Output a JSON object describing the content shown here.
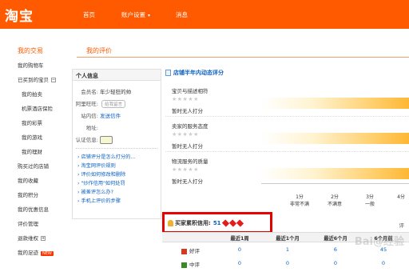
{
  "header": {
    "logo": "淘宝",
    "nav": [
      {
        "label": "首页"
      },
      {
        "label": "账户设置"
      },
      {
        "label": "消息"
      }
    ]
  },
  "tabs": [
    {
      "label": "我的评价"
    }
  ],
  "sidebar": {
    "title": "我的交易",
    "items": [
      {
        "label": "我的购物车"
      },
      {
        "label": "已买到的宝贝"
      },
      {
        "label": "我的拍卖"
      },
      {
        "label": "机票酒店保险"
      },
      {
        "label": "我的彩票"
      },
      {
        "label": "我的游戏"
      },
      {
        "label": "我的理财"
      },
      {
        "label": "购买过的店铺"
      },
      {
        "label": "我的收藏"
      },
      {
        "label": "我的积分"
      },
      {
        "label": "我的优惠信息"
      },
      {
        "label": "评价管理"
      },
      {
        "label": "退款维权"
      },
      {
        "label": "我的足迹",
        "badge": "NEW"
      }
    ]
  },
  "profile": {
    "title": "个人信息",
    "member_label": "会员名:",
    "member_value": "年少轻狂的帅",
    "wangwang_label": "阿里旺旺:",
    "wangwang_status": "给我留言",
    "mail_label": "站内信:",
    "mail_link": "发送信件",
    "address_label": "地址:",
    "cert_label": "认证信息:",
    "faq": [
      "店铺评分是怎么打分的...",
      "淘宝网评价规则",
      "评价如何修改和删除",
      "\"炒作信用\"如何处罚",
      "被差评怎么办?",
      "手机上评价的步骤"
    ]
  },
  "dynamic": {
    "title": "店铺半年内动态评分",
    "metrics": [
      {
        "label": "宝贝与描述相符",
        "stars": "★★★★★",
        "status": "暂时无人打分"
      },
      {
        "label": "卖家的服务态度",
        "stars": "★★★★★",
        "status": "暂时无人打分"
      },
      {
        "label": "物流服务的质量",
        "stars": "★★★★★",
        "status": "暂时无人打分"
      }
    ],
    "scale": [
      {
        "score": "1分",
        "desc": "非常不满"
      },
      {
        "score": "2分",
        "desc": "不满意"
      },
      {
        "score": "3分",
        "desc": "一般"
      },
      {
        "score": "4分",
        "desc": ""
      }
    ]
  },
  "credit": {
    "label": "买家累积信用:",
    "score": "51",
    "diamonds": 3
  },
  "review_tag": "评",
  "stats": {
    "headers": [
      "最近1周",
      "最近1个月",
      "最近6个月",
      "6个月前"
    ],
    "rows": [
      {
        "label": "好评",
        "values": [
          "0",
          "1",
          "6",
          "45"
        ]
      },
      {
        "label": "中评",
        "values": [
          "0",
          "0",
          "0",
          "0"
        ]
      }
    ]
  },
  "watermark": "Bai@经验",
  "colors": {
    "brand": "#ff5a00",
    "link": "#0a60c0",
    "highlight": "#e60000"
  }
}
